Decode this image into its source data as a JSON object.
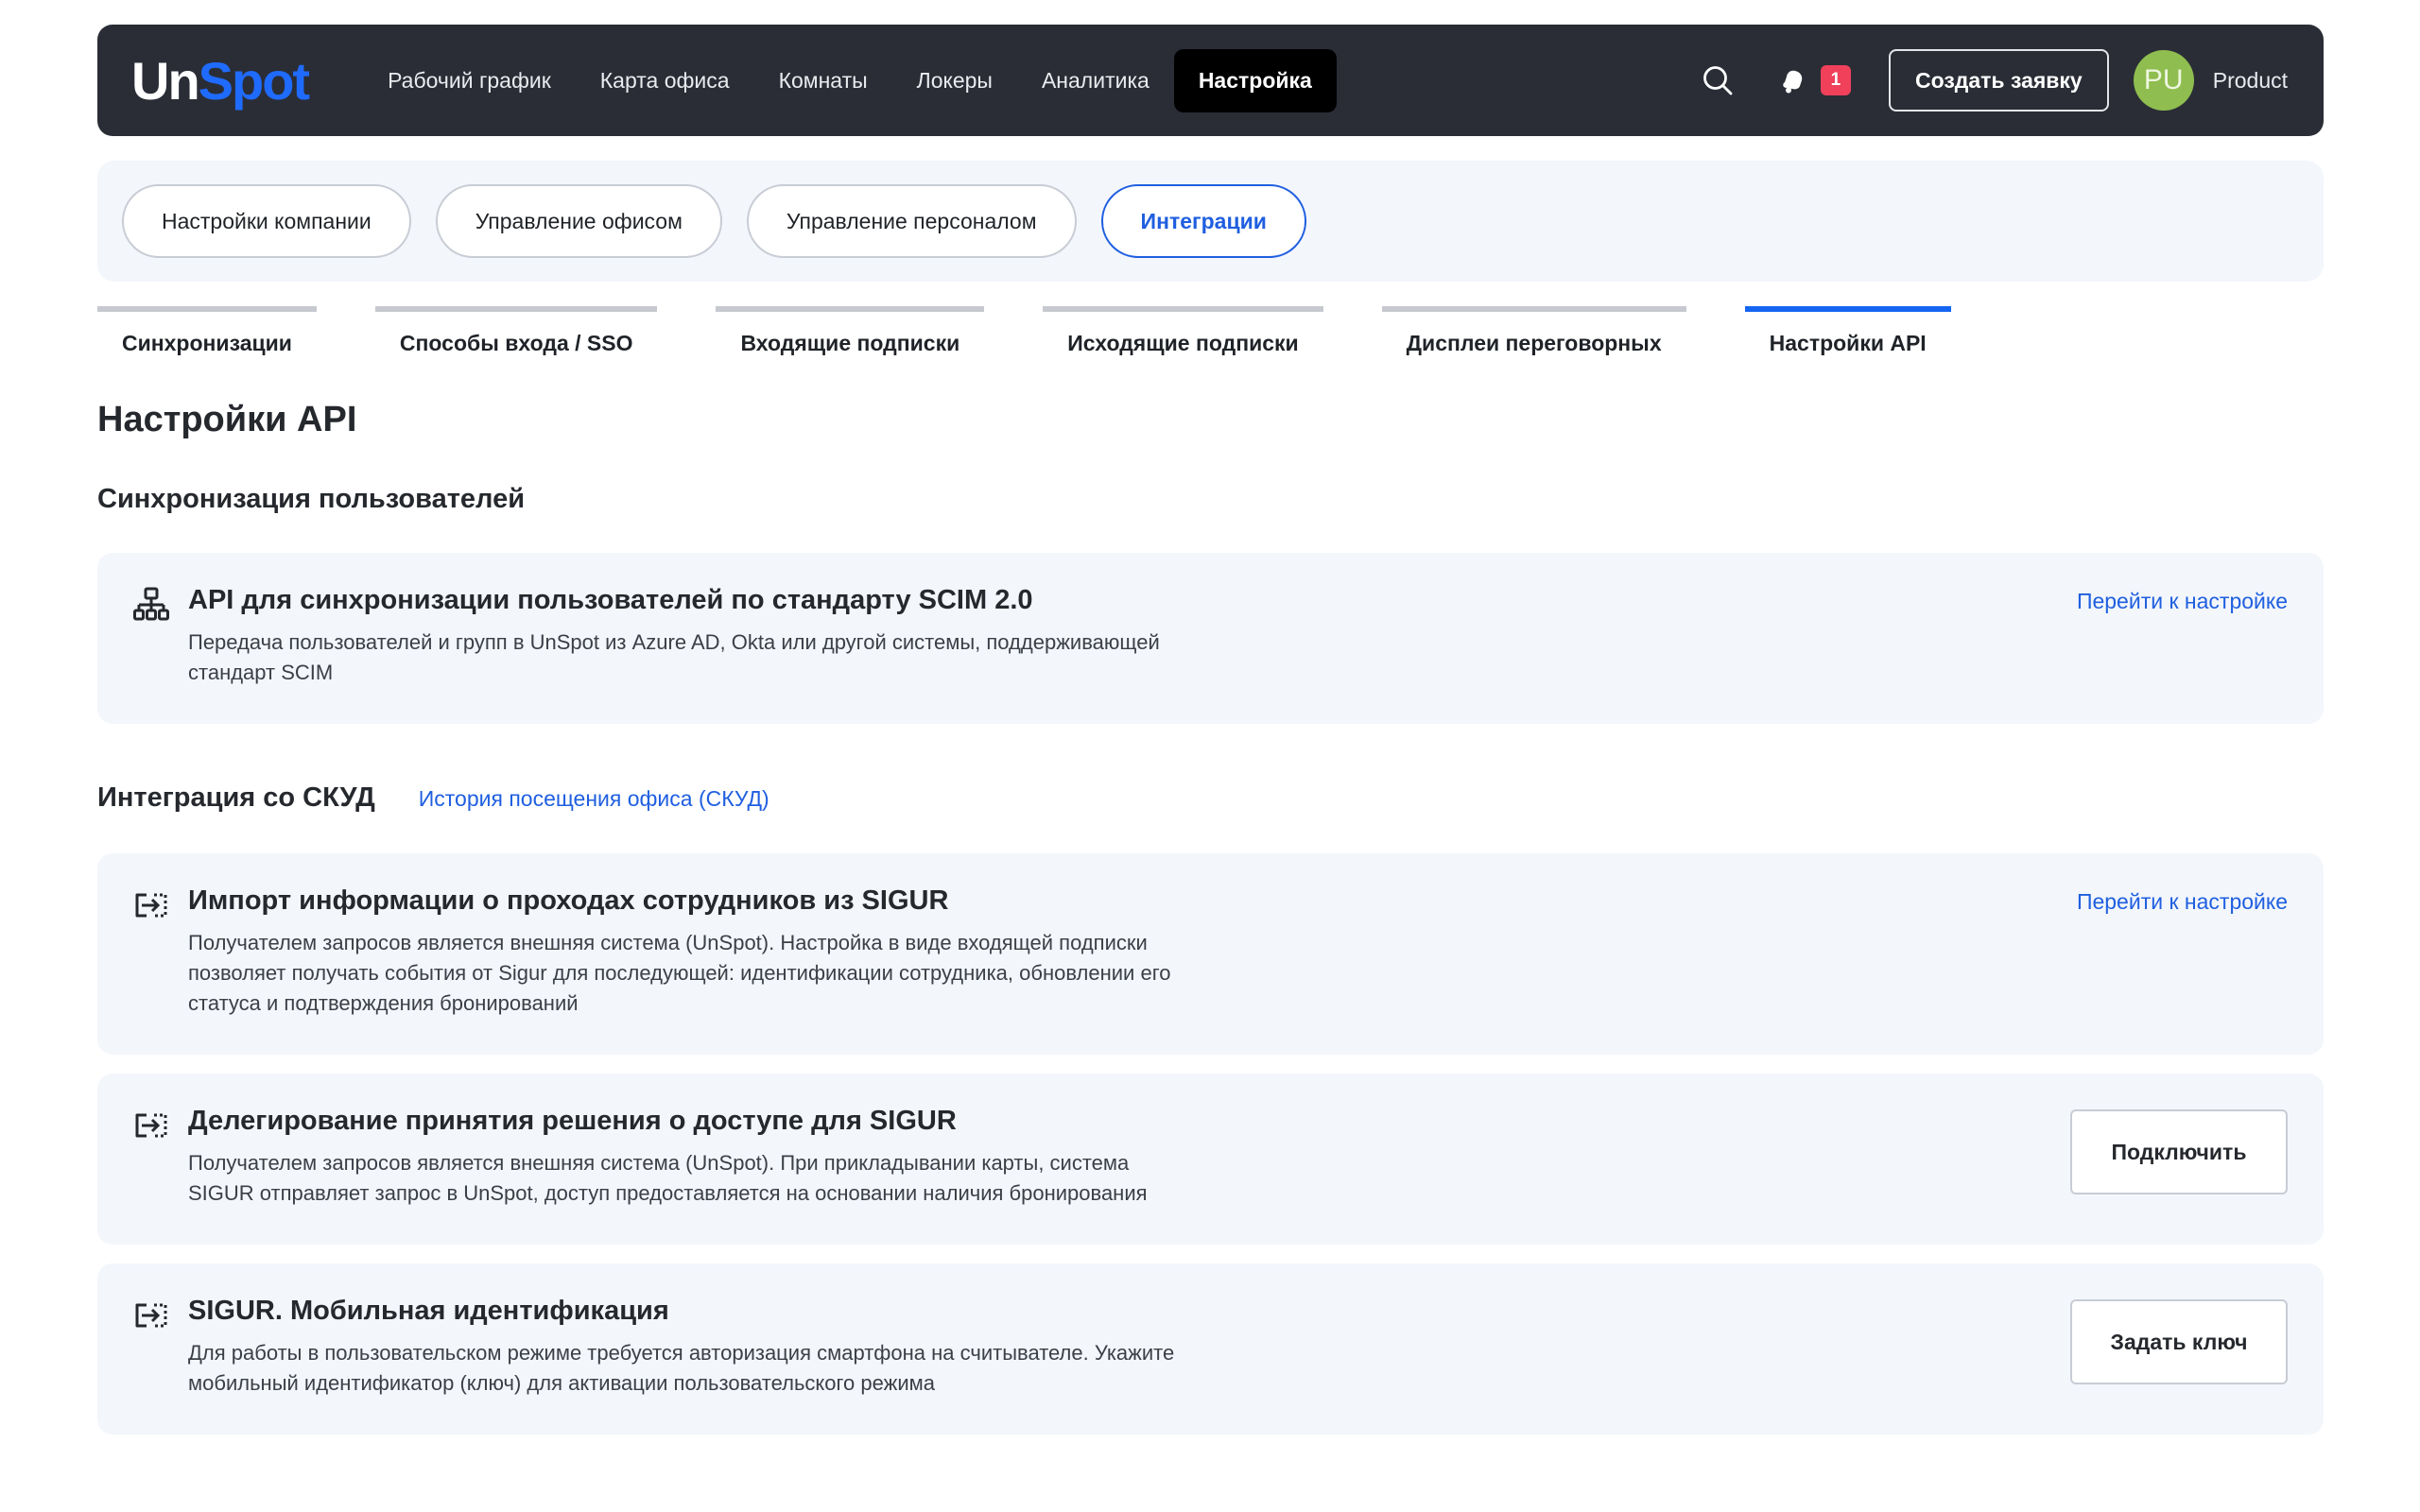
{
  "header": {
    "logo": {
      "un": "Un",
      "spot": "Spot"
    },
    "nav": [
      {
        "label": "Рабочий график"
      },
      {
        "label": "Карта офиса"
      },
      {
        "label": "Комнаты"
      },
      {
        "label": "Локеры"
      },
      {
        "label": "Аналитика"
      },
      {
        "label": "Настройка",
        "active": true
      }
    ],
    "notifications_count": "1",
    "create_button": "Создать заявку",
    "avatar_initials": "PU",
    "user_name": "Product"
  },
  "sections": [
    {
      "label": "Настройки компании"
    },
    {
      "label": "Управление офисом"
    },
    {
      "label": "Управление персоналом"
    },
    {
      "label": "Интеграции",
      "active": true
    }
  ],
  "subtabs": [
    {
      "label": "Синхронизации"
    },
    {
      "label": "Способы входа / SSO"
    },
    {
      "label": "Входящие подписки"
    },
    {
      "label": "Исходящие подписки"
    },
    {
      "label": "Дисплеи переговорных"
    },
    {
      "label": "Настройки API",
      "active": true
    }
  ],
  "page_title": "Настройки API",
  "sync_section": {
    "title": "Синхронизация пользователей",
    "card": {
      "icon": "network-icon",
      "title": "API для синхронизации пользователей по стандарту SCIM 2.0",
      "description": "Передача пользователей и групп в UnSpot из Azure AD, Okta или другой системы, поддерживающей стандарт SCIM",
      "link": "Перейти к настройке"
    }
  },
  "skud_section": {
    "title": "Интеграция со СКУД",
    "history_link": "История посещения офиса (СКУД)",
    "cards": [
      {
        "icon": "door-enter-icon",
        "title": "Импорт информации о проходах сотрудников из SIGUR",
        "description": "Получателем запросов является внешняя система (UnSpot). Настройка в виде входящей подписки позволяет получать события от Sigur для последующей: идентификации сотрудника, обновлении его статуса и подтверждения бронирований",
        "action": "Перейти к настройке"
      },
      {
        "icon": "door-enter-icon",
        "title": "Делегирование принятия решения о доступе для SIGUR",
        "description": "Получателем запросов является внешняя система (UnSpot). При прикладывании карты, система SIGUR отправляет запрос в UnSpot, доступ предоставляется на основании наличия бронирования",
        "action": "Подключить"
      },
      {
        "icon": "door-enter-icon",
        "title": "SIGUR. Мобильная идентификация",
        "description": "Для работы в пользовательском режиме требуется авторизация смартфона на считывателе. Укажите мобильный идентификатор (ключ) для активации пользовательского режима",
        "action": "Задать ключ"
      }
    ]
  },
  "colors": {
    "header_bg": "#2a2d36",
    "accent": "#1f5fe0",
    "card_bg": "#f3f6fb",
    "badge": "#f0405a",
    "avatar": "#8fbd4f"
  }
}
